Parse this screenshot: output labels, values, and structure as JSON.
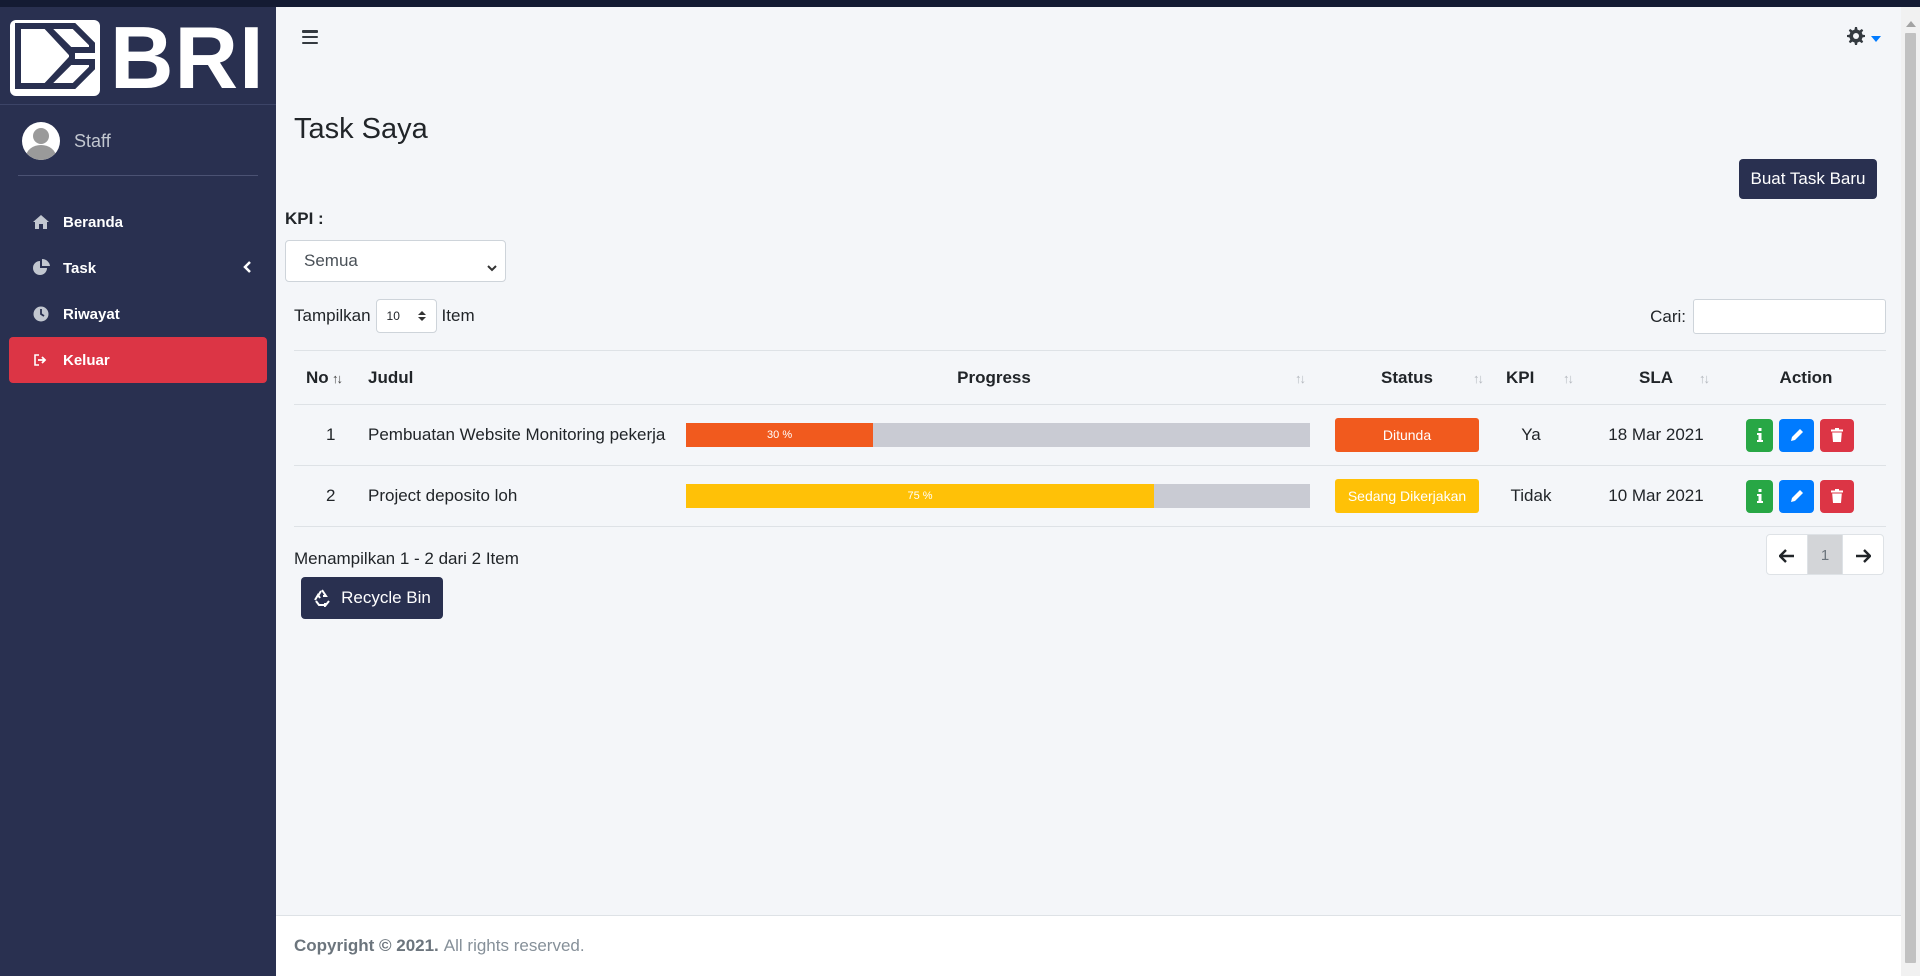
{
  "brand": {
    "name": "BRI"
  },
  "user": {
    "name": "Staff"
  },
  "nav": [
    {
      "label": "Beranda",
      "icon": "home-icon"
    },
    {
      "label": "Task",
      "icon": "pie-chart-icon"
    },
    {
      "label": "Riwayat",
      "icon": "clock-icon"
    },
    {
      "label": "Keluar",
      "icon": "sign-out-icon"
    }
  ],
  "page": {
    "title": "Task Saya",
    "new_task_button": "Buat Task Baru"
  },
  "filter": {
    "kpi_label": "KPI :",
    "kpi_selected": "Semua"
  },
  "table_controls": {
    "show_label": "Tampilkan",
    "length_value": "10",
    "item_label": "Item",
    "search_label": "Cari:"
  },
  "table": {
    "headers": [
      "No",
      "Judul",
      "Progress",
      "Status",
      "KPI",
      "SLA",
      "Action"
    ],
    "rows": [
      {
        "no": "1",
        "judul": "Pembuatan Website Monitoring pekerja",
        "progress": 30,
        "progress_label": "30 %",
        "status": "Ditunda",
        "kpi": "Ya",
        "sla": "18 Mar 2021"
      },
      {
        "no": "2",
        "judul": "Project deposito loh",
        "progress": 75,
        "progress_label": "75 %",
        "status": "Sedang Dikerjakan",
        "kpi": "Tidak",
        "sla": "10 Mar 2021"
      }
    ]
  },
  "table_info": "Menampilkan 1 - 2 dari 2 Item",
  "pagination": {
    "current": "1"
  },
  "recycle_button": "Recycle Bin",
  "footer": {
    "copyright": "Copyright © 2021.",
    "rights": "All rights reserved."
  },
  "colors": {
    "sidebar": "#293050",
    "danger": "#dc3545",
    "warning": "#ffc107",
    "orange": "#f15a1e",
    "success": "#28a745",
    "primary": "#007bff"
  }
}
